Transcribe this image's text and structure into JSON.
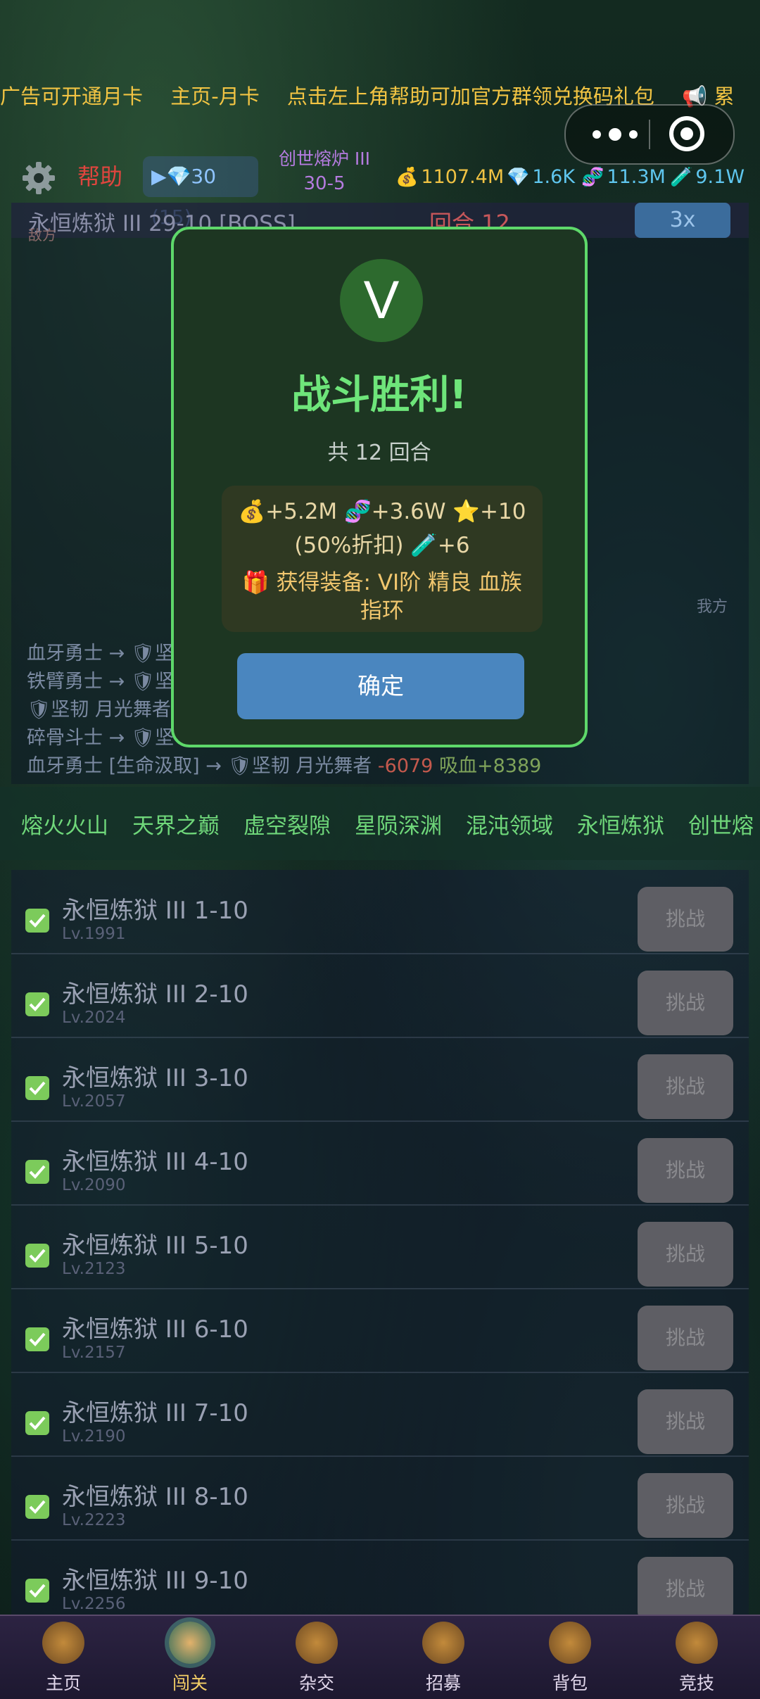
{
  "marquee": {
    "items": [
      "广告可开通月卡",
      "主页-月卡",
      "点击左上角帮助可加官方群领兑换码礼包",
      "📢 累"
    ]
  },
  "header": {
    "help_label": "帮助",
    "ad_label": "▶💎30 (15)",
    "stage_name": "创世熔炉 III",
    "stage_num": "30-5",
    "gold": "1107.4M",
    "diamond": "1.6K",
    "dna": "11.3M",
    "potion": "9.1W"
  },
  "battle": {
    "title": "永恒炼狱 III 29-10 [BOSS]",
    "enemy_label": "敌方",
    "round_label": "回合 12",
    "speed_label": "3x",
    "self_label": "我方",
    "log": [
      {
        "text": "血牙勇士 → 🛡坚",
        "hit": "",
        "heal": ""
      },
      {
        "text": "铁臂勇士 → 🛡坚",
        "hit": "",
        "heal": ""
      },
      {
        "text": "🛡坚韧 月光舞者",
        "hit": "",
        "heal": ""
      },
      {
        "text": "碎骨斗士 → 🛡坚",
        "hit": "",
        "heal": ""
      },
      {
        "text": "血牙勇士 [生命汲取] → 🛡坚韧 月光舞者",
        "hit": "-6079",
        "heal": "吸血+8389"
      }
    ]
  },
  "modal": {
    "icon_letter": "V",
    "title": "战斗胜利!",
    "rounds": "共 12 回合",
    "reward_line1": "💰+5.2M  🧬+3.6W  ⭐+10",
    "reward_line2": "(50%折扣) 🧪+6",
    "reward_line3": "🎁 获得装备: VI阶 精良 血族指环",
    "confirm_label": "确定"
  },
  "tabs": [
    "熔火火山",
    "天界之巅",
    "虚空裂隙",
    "星陨深渊",
    "混沌领域",
    "永恒炼狱",
    "创世熔"
  ],
  "levels": [
    {
      "name": "永恒炼狱 III 1-10",
      "lv": "Lv.1991",
      "btn": "挑战"
    },
    {
      "name": "永恒炼狱 III 2-10",
      "lv": "Lv.2024",
      "btn": "挑战"
    },
    {
      "name": "永恒炼狱 III 3-10",
      "lv": "Lv.2057",
      "btn": "挑战"
    },
    {
      "name": "永恒炼狱 III 4-10",
      "lv": "Lv.2090",
      "btn": "挑战"
    },
    {
      "name": "永恒炼狱 III 5-10",
      "lv": "Lv.2123",
      "btn": "挑战"
    },
    {
      "name": "永恒炼狱 III 6-10",
      "lv": "Lv.2157",
      "btn": "挑战"
    },
    {
      "name": "永恒炼狱 III 7-10",
      "lv": "Lv.2190",
      "btn": "挑战"
    },
    {
      "name": "永恒炼狱 III 8-10",
      "lv": "Lv.2223",
      "btn": "挑战"
    },
    {
      "name": "永恒炼狱 III 9-10",
      "lv": "Lv.2256",
      "btn": "挑战"
    }
  ],
  "nav": [
    {
      "label": "主页",
      "icon": "home-icon"
    },
    {
      "label": "闯关",
      "icon": "battle-icon"
    },
    {
      "label": "杂交",
      "icon": "breed-icon"
    },
    {
      "label": "招募",
      "icon": "recruit-icon"
    },
    {
      "label": "背包",
      "icon": "bag-icon"
    },
    {
      "label": "竞技",
      "icon": "arena-icon"
    }
  ],
  "colors": {
    "accent_green": "#6ee57a",
    "modal_border": "#5ed86a",
    "confirm_blue": "#4a86bf",
    "marquee_gold": "#f2c443",
    "help_red": "#e0453e"
  }
}
